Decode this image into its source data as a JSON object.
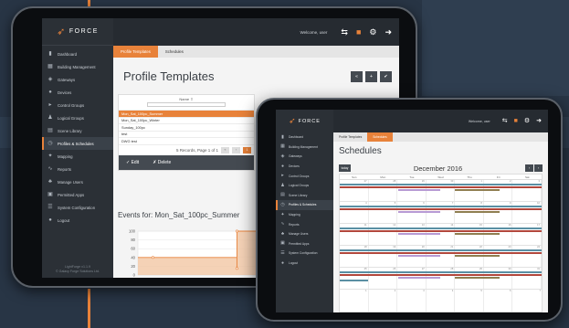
{
  "colors": {
    "accent": "#e8823a",
    "sidebar": "#2b3036",
    "topbar": "#262b31",
    "background": "#283545",
    "teal": "#5a8fa3",
    "red": "#b2473c",
    "purple": "#b79ad4",
    "olive": "#8f7e50"
  },
  "app": {
    "logo_text": "FORCE",
    "welcome": "Welcome, user"
  },
  "sidebar": {
    "items": [
      {
        "label": "Dashboard",
        "icon": "bar-chart-icon"
      },
      {
        "label": "Building Management",
        "icon": "building-icon"
      },
      {
        "label": "Gateways",
        "icon": "gateway-icon"
      },
      {
        "label": "Devices",
        "icon": "bulb-icon"
      },
      {
        "label": "Control Groups",
        "icon": "control-groups-icon"
      },
      {
        "label": "Logical Groups",
        "icon": "logical-groups-icon"
      },
      {
        "label": "Scene Library",
        "icon": "scene-icon"
      },
      {
        "label": "Profiles & Schedules",
        "icon": "clock-icon"
      },
      {
        "label": "Mapping",
        "icon": "map-pin-icon"
      },
      {
        "label": "Reports",
        "icon": "pulse-icon"
      },
      {
        "label": "Manage Users",
        "icon": "users-icon"
      },
      {
        "label": "Permitted Apps",
        "icon": "apps-icon"
      },
      {
        "label": "System Configuration",
        "icon": "config-icon"
      },
      {
        "label": "Logout",
        "icon": "logout-icon"
      }
    ],
    "footer_line1": "LightForge v1.1.9",
    "footer_line2": "© Galaxy Forge Solutions Ltd."
  },
  "profiles_view": {
    "tabs": [
      "Profile Templates",
      "Schedules"
    ],
    "title": "Profile Templates",
    "table": {
      "header": "Name ⇧",
      "rows": [
        "Mon_Sat_100pc_Summer",
        "Mon_Sat_100pc_Winter",
        "Sunday_100pc",
        "test",
        "DWG test"
      ],
      "selected_index": 0,
      "pager_text": "5 Records, Page 1 of 1",
      "current_page": "1"
    },
    "edit_label": "✓  Edit",
    "delete_label": "✗  Delete",
    "events_title": "Events for: Mon_Sat_100pc_Summer",
    "chart_data": {
      "type": "line",
      "y_ticks": [
        "100",
        "80",
        "60",
        "40",
        "20",
        "0"
      ],
      "x_ticks": [
        "00:00",
        "04:00",
        "08:00"
      ],
      "ylim": [
        0,
        100
      ],
      "x": [
        0,
        0.5,
        0.5,
        3.3,
        3.3,
        3.3,
        8.4
      ],
      "y": [
        40,
        40,
        40,
        40,
        15,
        100,
        100
      ],
      "grid": true
    }
  },
  "schedules_view": {
    "tabs": [
      "Profile Templates",
      "Schedules"
    ],
    "title": "Schedules",
    "today_label": "today",
    "month_label": "December 2016",
    "days_of_week": [
      "Sun",
      "Mon",
      "Tue",
      "Wed",
      "Thu",
      "Fri",
      "Sat"
    ],
    "weeks": [
      [
        "27",
        "28",
        "29",
        "30",
        "1",
        "2",
        "3"
      ],
      [
        "4",
        "5",
        "6",
        "7",
        "8",
        "9",
        "10"
      ],
      [
        "11",
        "12",
        "13",
        "14",
        "15",
        "16",
        "17"
      ],
      [
        "18",
        "19",
        "20",
        "21",
        "22",
        "23",
        "24"
      ],
      [
        "25",
        "26",
        "27",
        "28",
        "29",
        "30",
        "31"
      ],
      [
        "1",
        "2",
        "3",
        "4",
        "5",
        "6",
        "7"
      ]
    ]
  }
}
